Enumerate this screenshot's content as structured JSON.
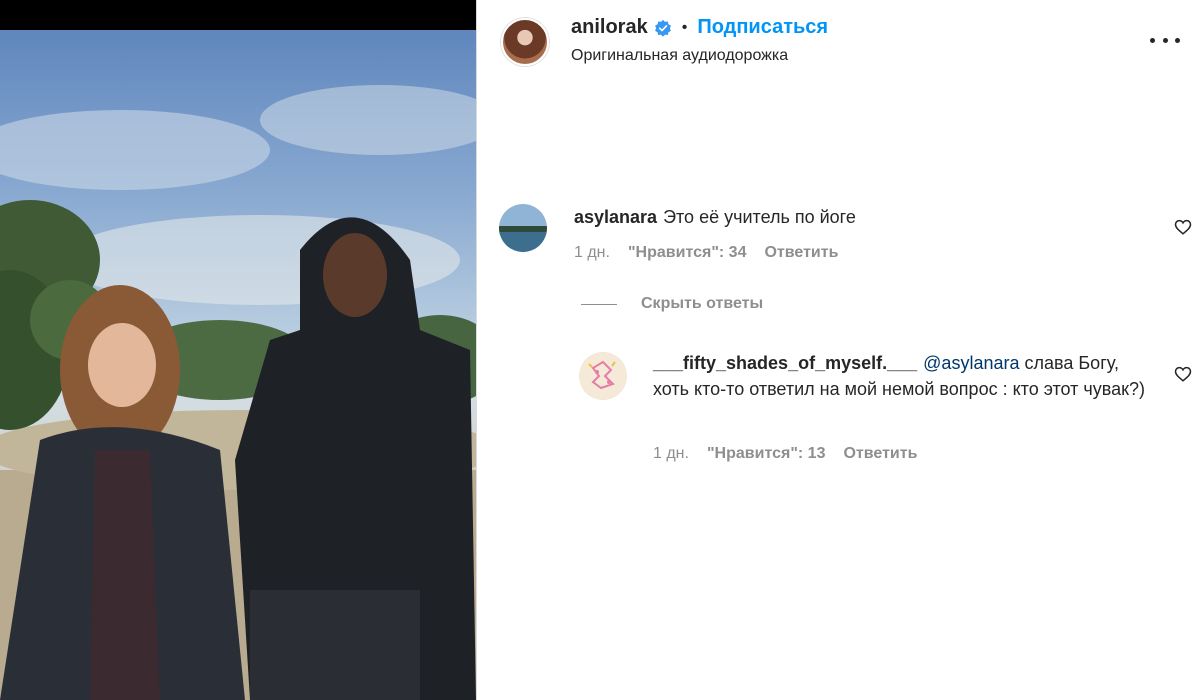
{
  "post": {
    "author": "anilorak",
    "follow_label": "Подписаться",
    "separator": "•",
    "audio": "Оригинальная аудиодорожка"
  },
  "icons": {
    "verified": "verified-badge-icon",
    "more": "more-options-icon",
    "like": "heart-icon"
  },
  "colors": {
    "accent": "#0095f6",
    "text": "#262626",
    "muted": "#8e8e8e",
    "mention": "#00376b"
  },
  "comments": [
    {
      "username": "asylanara",
      "text": "Это её учитель по йоге",
      "time": "1 дн.",
      "likes": "\"Нравится\": 34",
      "reply": "Ответить",
      "hide_replies": "Скрыть ответы",
      "replies": [
        {
          "username": "___fifty_shades_of_myself.___",
          "mention": "@asylanara",
          "text": " слава Богу, хоть кто-то ответил на мой немой вопрос : кто этот чувак?)",
          "time": "1 дн.",
          "likes": "\"Нравится\": 13",
          "reply": "Ответить"
        }
      ]
    }
  ]
}
